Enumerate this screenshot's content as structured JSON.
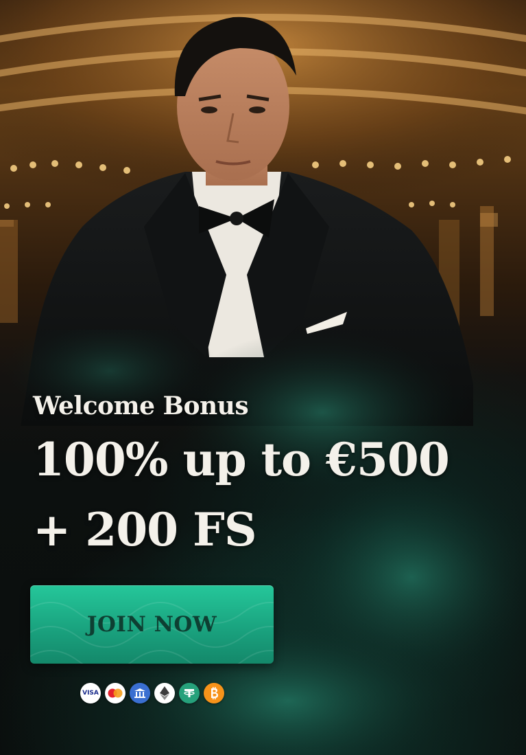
{
  "promo": {
    "welcome_label": "Welcome Bonus",
    "offer_line_1": "100% up to €500",
    "offer_line_2": "+ 200 FS"
  },
  "cta": {
    "join_label": "JOIN NOW"
  },
  "payment_methods": [
    {
      "icon": "visa-icon",
      "label": "VISA"
    },
    {
      "icon": "mastercard-icon"
    },
    {
      "icon": "bank-icon"
    },
    {
      "icon": "ethereum-icon"
    },
    {
      "icon": "tether-icon"
    },
    {
      "icon": "bitcoin-icon"
    }
  ],
  "colors": {
    "button": "#1fb58c",
    "button_text": "#0e3f32",
    "headline": "#f4f1ea",
    "ambient_gold": "#d99a45",
    "smoke_teal": "#1c6f5c"
  }
}
